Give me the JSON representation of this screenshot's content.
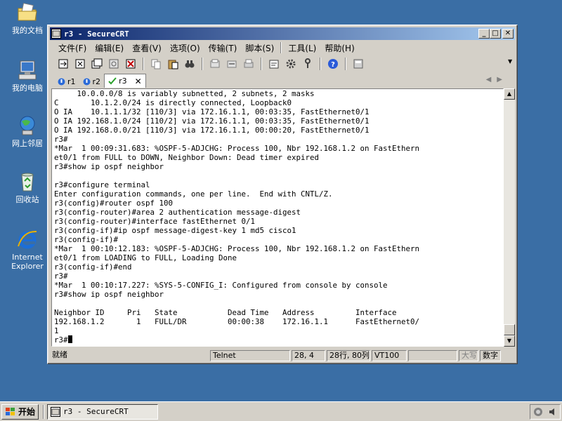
{
  "desktop": {
    "icons": [
      {
        "label": "我的文档",
        "icon": "folder-documents-icon"
      },
      {
        "label": "我的电脑",
        "icon": "computer-icon"
      },
      {
        "label": "网上邻居",
        "icon": "network-icon"
      },
      {
        "label": "回收站",
        "icon": "recycle-bin-icon"
      },
      {
        "label": "Internet Explorer",
        "icon": "internet-explorer-icon"
      }
    ]
  },
  "window": {
    "title": "r3 - SecureCRT",
    "title_bar_color": "#0a246a"
  },
  "menu": {
    "items": [
      "文件(F)",
      "编辑(E)",
      "查看(V)",
      "选项(O)",
      "传输(T)",
      "脚本(S)",
      "工具(L)",
      "帮助(H)"
    ]
  },
  "tabs": [
    {
      "label": "r1",
      "status": "connecting"
    },
    {
      "label": "r2",
      "status": "connecting"
    },
    {
      "label": "r3",
      "status": "connected",
      "active": true
    }
  ],
  "terminal": {
    "lines": [
      "     10.0.0.0/8 is variably subnetted, 2 subnets, 2 masks",
      "C       10.1.2.0/24 is directly connected, Loopback0",
      "O IA    10.1.1.1/32 [110/3] via 172.16.1.1, 00:03:35, FastEthernet0/1",
      "O IA 192.168.1.0/24 [110/2] via 172.16.1.1, 00:03:35, FastEthernet0/1",
      "O IA 192.168.0.0/21 [110/3] via 172.16.1.1, 00:00:20, FastEthernet0/1",
      "r3#",
      "*Mar  1 00:09:31.683: %OSPF-5-ADJCHG: Process 100, Nbr 192.168.1.2 on FastEthern",
      "et0/1 from FULL to DOWN, Neighbor Down: Dead timer expired",
      "r3#show ip ospf neighbor",
      "",
      "r3#configure terminal",
      "Enter configuration commands, one per line.  End with CNTL/Z.",
      "r3(config)#router ospf 100",
      "r3(config-router)#area 2 authentication message-digest",
      "r3(config-router)#interface fastEthernet 0/1",
      "r3(config-if)#ip ospf message-digest-key 1 md5 cisco1",
      "r3(config-if)#",
      "*Mar  1 00:10:12.183: %OSPF-5-ADJCHG: Process 100, Nbr 192.168.1.2 on FastEthern",
      "et0/1 from LOADING to FULL, Loading Done",
      "r3(config-if)#end",
      "r3#",
      "*Mar  1 00:10:17.227: %SYS-5-CONFIG_I: Configured from console by console",
      "r3#show ip ospf neighbor",
      "",
      "Neighbor ID     Pri   State           Dead Time   Address         Interface",
      "192.168.1.2       1   FULL/DR         00:00:38    172.16.1.1      FastEthernet0/",
      "1"
    ],
    "prompt": "r3#"
  },
  "status": {
    "ready": "就绪",
    "protocol": "Telnet",
    "cursor_pos": "28,  4",
    "size": "28行, 80列",
    "emulation": "VT100",
    "caps": "大写",
    "num": "数字"
  },
  "taskbar": {
    "start_label": "开始",
    "task_label": "r3 - SecureCRT"
  }
}
